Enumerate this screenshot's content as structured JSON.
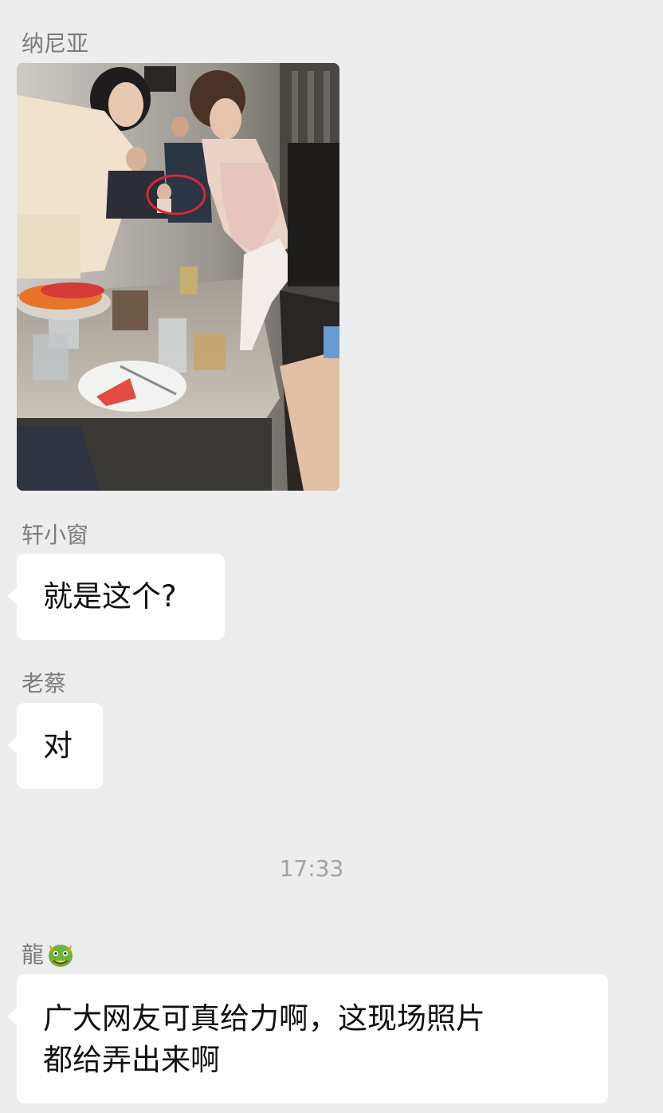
{
  "messages": [
    {
      "sender": "纳尼亚",
      "type": "image"
    },
    {
      "sender": "轩小窗",
      "text": "就是这个?"
    },
    {
      "sender": "老蔡",
      "text": "对"
    },
    {
      "sender": "龍",
      "sender_icon": "dragon-emoji-icon",
      "text_lines": [
        "广大网友可真给力啊，这现场照片",
        "都给弄出来啊"
      ]
    }
  ],
  "timestamp": "17:33",
  "colors": {
    "background": "#ededed",
    "bubble": "#ffffff",
    "sender_name": "#7b7b7b",
    "timestamp": "#a3a3a3",
    "highlight_circle": "#d6283a"
  }
}
